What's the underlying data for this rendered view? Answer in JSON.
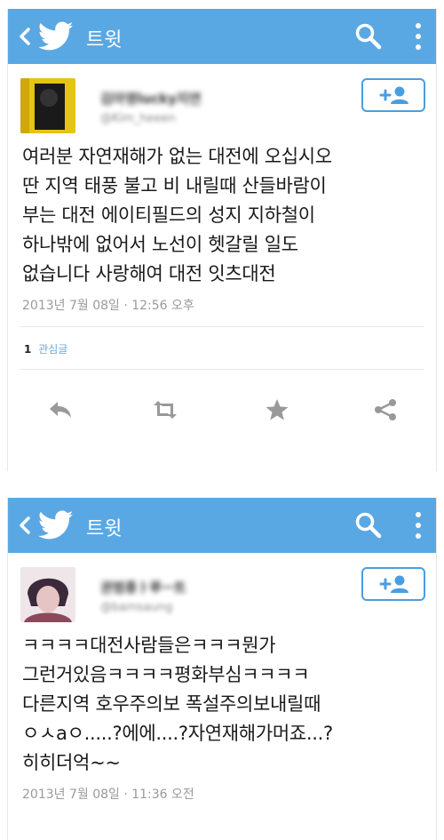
{
  "colors": {
    "appbar": "#5aa8e3",
    "accent": "#4a9ee0",
    "text": "#1a1a1a",
    "muted": "#9a9a9a",
    "icon": "#999999"
  },
  "panels": [
    {
      "appbar": {
        "title": "트윗"
      },
      "user": {
        "name": "김아영lucky지연",
        "handle": "@Kim_heeen"
      },
      "tweet": {
        "text": "여러분 자연재해가 없는 대전에 오십시오\n딴 지역 태풍 불고 비 내릴때 산들바람이\n부는 대전 에이티필드의 성지 지하철이\n하나밖에 없어서 노선이 헷갈릴 일도\n없습니다 사랑해여 대전 잇츠대전",
        "time": "2013년 7월 08일 · 12:56 오후"
      },
      "stats": {
        "count": "1",
        "label": "관심글"
      }
    },
    {
      "appbar": {
        "title": "트윗"
      },
      "user": {
        "name": "권범종ㅏ루ㅡ트",
        "handle": "@bamsaung"
      },
      "tweet": {
        "text": "ㅋㅋㅋㅋ대전사람들은ㅋㅋㅋ뭔가\n그런거있음ㅋㅋㅋㅋ평화부심ㅋㅋㅋㅋ\n다른지역 호우주의보 폭설주의보내릴때\nㅇㅅaㅇ.....?에에....?자연재해가머죠...?\n히히더억~~",
        "time": "2013년 7월 08일 · 11:36 오전"
      }
    }
  ]
}
